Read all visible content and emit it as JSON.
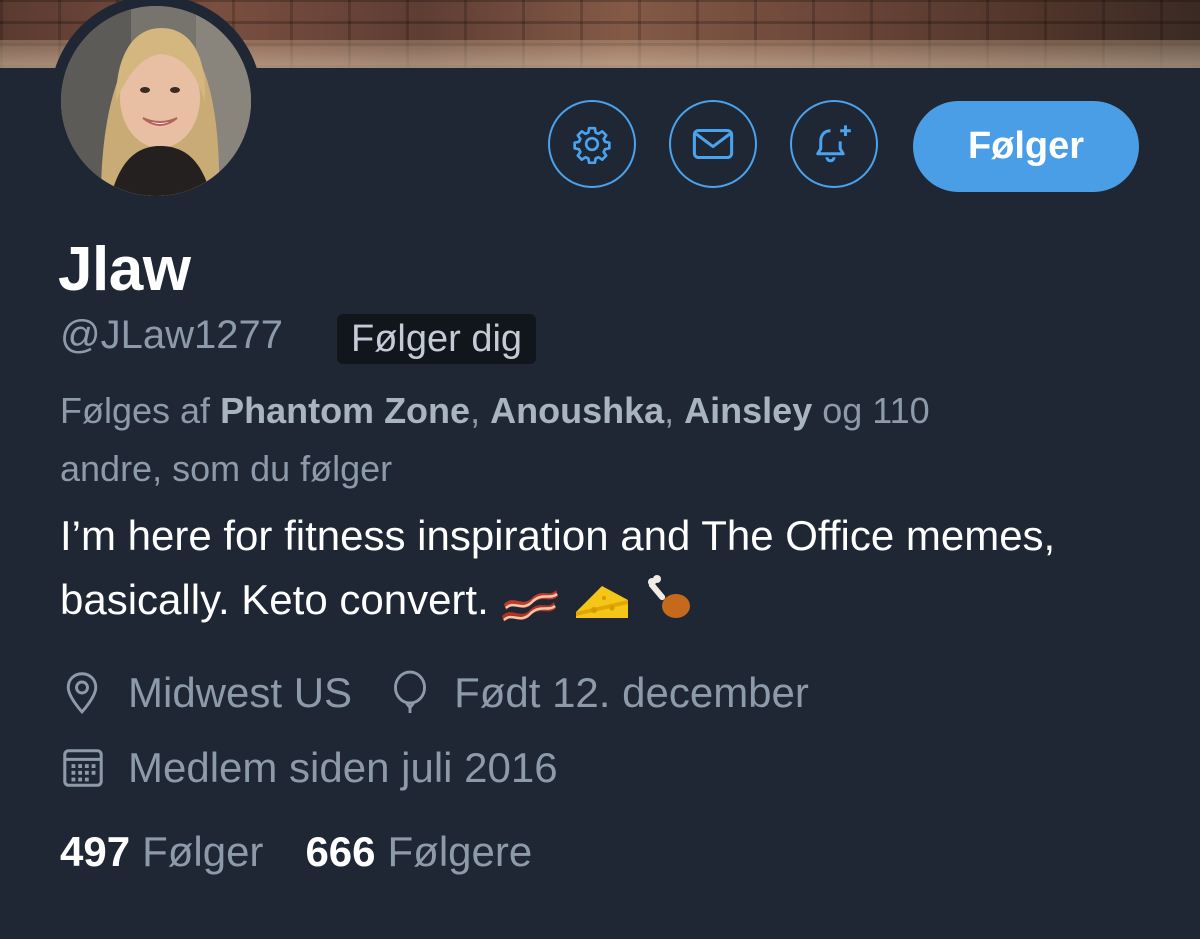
{
  "profile": {
    "name": "Jlaw",
    "handle": "@JLaw1277",
    "follows_you_badge": "Følger dig"
  },
  "actions": {
    "follow_label": "Følger",
    "icons": [
      "gear-icon",
      "mail-icon",
      "bell-plus-icon"
    ]
  },
  "followed_by": {
    "prefix": "Følges af",
    "names": [
      "Phantom Zone",
      "Anoushka",
      "Ainsley"
    ],
    "sep": ",",
    "suffix_count": "og 110",
    "suffix_rest": "andre, som du følger"
  },
  "bio": {
    "text": "I’m here for fitness inspiration and The Office memes, basically. Keto convert.",
    "emojis": [
      "bacon",
      "cheese",
      "poultry-leg"
    ]
  },
  "meta": {
    "location": "Midwest US",
    "birthday": "Født 12. december",
    "joined": "Medlem siden juli 2016"
  },
  "stats": {
    "following_count": "497",
    "following_label": "Følger",
    "followers_count": "666",
    "followers_label": "Følgere"
  },
  "colors": {
    "background": "#1f2735",
    "accent": "#4a9ee6",
    "muted_text": "#8d9aaa",
    "badge_bg": "#11161d"
  }
}
